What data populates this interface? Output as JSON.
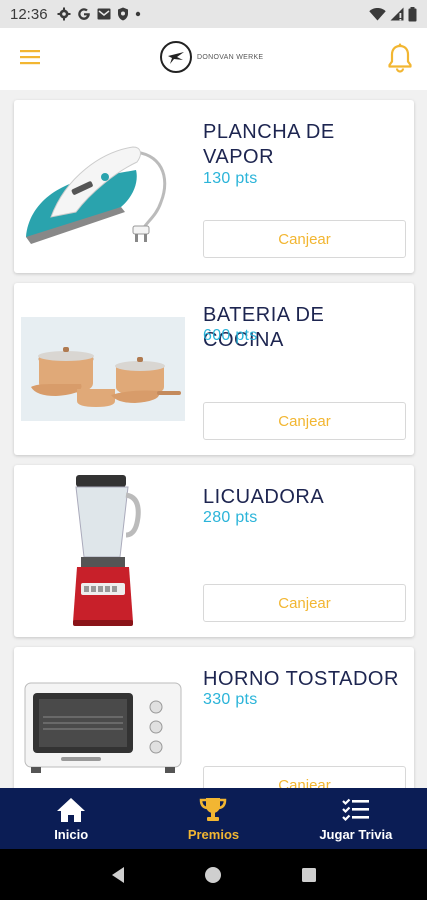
{
  "status_bar": {
    "time": "12:36",
    "icons_left": [
      "gear-icon",
      "google-icon",
      "gmail-icon",
      "shield-icon",
      "dot-icon"
    ],
    "icons_right": [
      "wifi-icon",
      "signal-icon",
      "battery-icon"
    ]
  },
  "header": {
    "logo_text": "DONOVAN WERKE",
    "menu_icon": "hamburger-menu-icon",
    "bell_icon": "bell-icon",
    "accent_color": "#F2B632"
  },
  "products": [
    {
      "title": "PLANCHA DE VAPOR",
      "points": "130 pts",
      "button": "Canjear",
      "image": "steam-iron"
    },
    {
      "title": "BATERIA DE COCINA",
      "points": "600 pts",
      "button": "Canjear",
      "image": "cookware-set"
    },
    {
      "title": "LICUADORA",
      "points": "280 pts",
      "button": "Canjear",
      "image": "blender"
    },
    {
      "title": "HORNO TOSTADOR",
      "points": "330 pts",
      "button": "Canjear",
      "image": "toaster-oven"
    }
  ],
  "bottom_nav": {
    "items": [
      {
        "label": "Inicio",
        "icon": "home-icon",
        "active": false
      },
      {
        "label": "Premios",
        "icon": "trophy-icon",
        "active": true
      },
      {
        "label": "Jugar Trivia",
        "icon": "checklist-icon",
        "active": false
      }
    ],
    "background": "#0B1D55",
    "active_color": "#F2B632"
  },
  "system_nav": [
    "back-icon",
    "home-circle-icon",
    "recents-icon"
  ],
  "colors": {
    "title": "#1D2550",
    "points": "#2BB4D9",
    "button_text": "#F2B632"
  }
}
